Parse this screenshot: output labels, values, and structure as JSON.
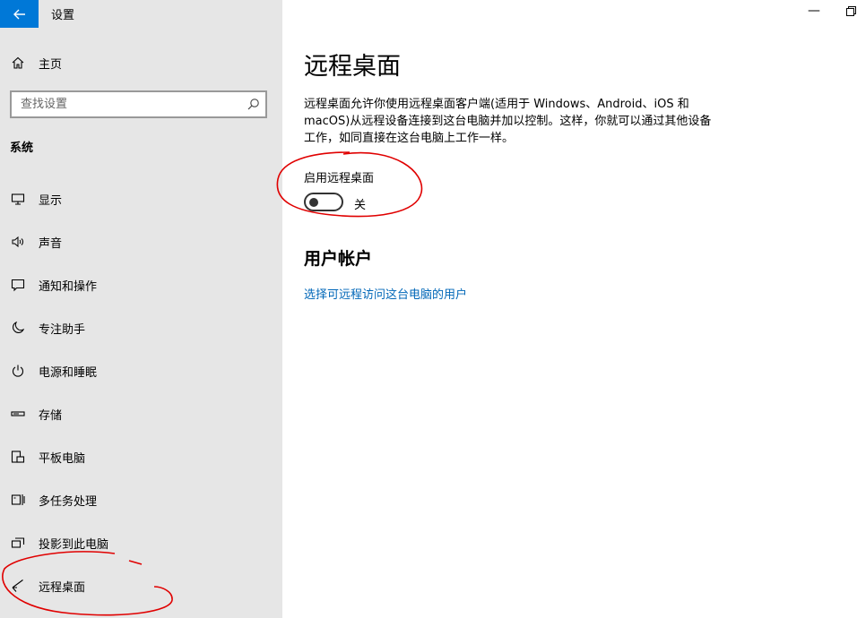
{
  "window": {
    "title": "设置",
    "minimize_glyph": "—"
  },
  "sidebar": {
    "home_label": "主页",
    "search": {
      "placeholder": "查找设置"
    },
    "section_title": "系统",
    "items": [
      {
        "label": "显示",
        "icon": "monitor-icon"
      },
      {
        "label": "声音",
        "icon": "speaker-icon"
      },
      {
        "label": "通知和操作",
        "icon": "notification-icon"
      },
      {
        "label": "专注助手",
        "icon": "moon-icon"
      },
      {
        "label": "电源和睡眠",
        "icon": "power-icon"
      },
      {
        "label": "存储",
        "icon": "storage-icon"
      },
      {
        "label": "平板电脑",
        "icon": "tablet-icon"
      },
      {
        "label": "多任务处理",
        "icon": "multitask-icon"
      },
      {
        "label": "投影到此电脑",
        "icon": "project-icon"
      },
      {
        "label": "远程桌面",
        "icon": "remote-desktop-icon"
      }
    ]
  },
  "main": {
    "title": "远程桌面",
    "description": "远程桌面允许你使用远程桌面客户端(适用于 Windows、Android、iOS 和 macOS)从远程设备连接到这台电脑并加以控制。这样，你就可以通过其他设备工作，如同直接在这台电脑上工作一样。",
    "toggle_label": "启用远程桌面",
    "toggle_state": "关",
    "toggle_on": false,
    "user_section_title": "用户帐户",
    "user_link": "选择可远程访问这台电脑的用户"
  },
  "colors": {
    "accent": "#0078d7",
    "link": "#0067b8",
    "sidebar_bg": "#e6e6e6",
    "annotation": "#e00000"
  }
}
